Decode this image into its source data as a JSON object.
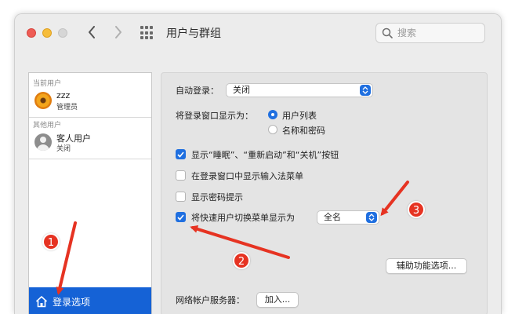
{
  "window": {
    "title": "用户与群组",
    "search": {
      "placeholder": "搜索"
    }
  },
  "sidebar": {
    "current_users_label": "当前用户",
    "current_user": {
      "name": "zzz",
      "role": "管理员",
      "avatar": "flower-avatar"
    },
    "other_users_label": "其他用户",
    "guest_user": {
      "name": "客人用户",
      "status": "关闭",
      "avatar": "guest-avatar"
    },
    "login_options_label": "登录选项"
  },
  "main": {
    "auto_login": {
      "label": "自动登录：",
      "value": "关闭"
    },
    "display_login_window": {
      "label": "将登录窗口显示为：",
      "options": [
        {
          "label": "用户列表",
          "selected": true
        },
        {
          "label": "名称和密码",
          "selected": false
        }
      ]
    },
    "checkboxes": [
      {
        "label": "显示“睡眠”、“重新启动”和“关机”按钮",
        "checked": true
      },
      {
        "label": "在登录窗口中显示输入法菜单",
        "checked": false
      },
      {
        "label": "显示密码提示",
        "checked": false
      },
      {
        "label": "将快速用户切换菜单显示为",
        "checked": true
      }
    ],
    "fast_user_switch_value": "全名",
    "accessibility_button": "辅助功能选项...",
    "network_server": {
      "label": "网络帐户服务器：",
      "button": "加入..."
    }
  },
  "annotations": {
    "badges": [
      "1",
      "2",
      "3"
    ],
    "color": "#e63322"
  },
  "colors": {
    "accent": "#1f6fe0",
    "selection": "#1562d6"
  }
}
